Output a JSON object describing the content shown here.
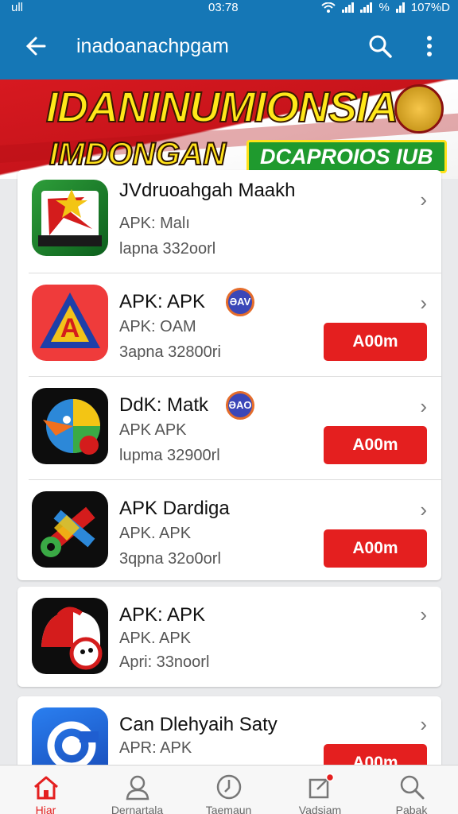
{
  "status_bar": {
    "left": "ull",
    "time": "03:78",
    "percent_symbol": "%",
    "battery": "107%D"
  },
  "app_bar": {
    "title": "inadoanachpgam",
    "back_icon": "arrow-left-icon",
    "search_icon": "search-icon",
    "menu_icon": "more-vert-icon"
  },
  "banner": {
    "line1": "IDANINUMIONSIA",
    "line2": "IMDONGAN",
    "pill": "DCAPROIOS IUB"
  },
  "apps": [
    {
      "name": "JVdruoahgah Maakh",
      "sub": "APK: Malı",
      "meta": "lapna 332oorl"
    },
    {
      "name": "APK: APK",
      "badge": "ƏAV",
      "sub": "APK: OAM",
      "meta": "3apna 32800ri",
      "button": "A00m"
    },
    {
      "name": "DdK: Matk",
      "badge": "ƏAO",
      "sub": "APK APK",
      "meta": "lupma 32900rl",
      "button": "A00m"
    },
    {
      "name": "APK Dardiga",
      "sub": "APK. APK",
      "meta": "3qpna 32o0orl",
      "button": "A00m"
    },
    {
      "name": "APK: APK",
      "sub": "APK. APK",
      "meta": "Apri: 33noorl"
    },
    {
      "name": "Can Dlehyaih Saty",
      "sub": "APR: APK",
      "button": "A00m"
    }
  ],
  "nav": [
    {
      "label": "Hiar",
      "icon": "home-icon"
    },
    {
      "label": "Dernartala",
      "icon": "user-icon"
    },
    {
      "label": "Taemaun",
      "icon": "clock-icon"
    },
    {
      "label": "Vadsiam",
      "icon": "notification-icon"
    },
    {
      "label": "Pabak",
      "icon": "search-icon"
    }
  ],
  "colors": {
    "primary": "#1577b6",
    "accent": "#e41f1f",
    "banner_red": "#d71920",
    "banner_yellow": "#ffe81a",
    "banner_green": "#1f9a2e"
  }
}
